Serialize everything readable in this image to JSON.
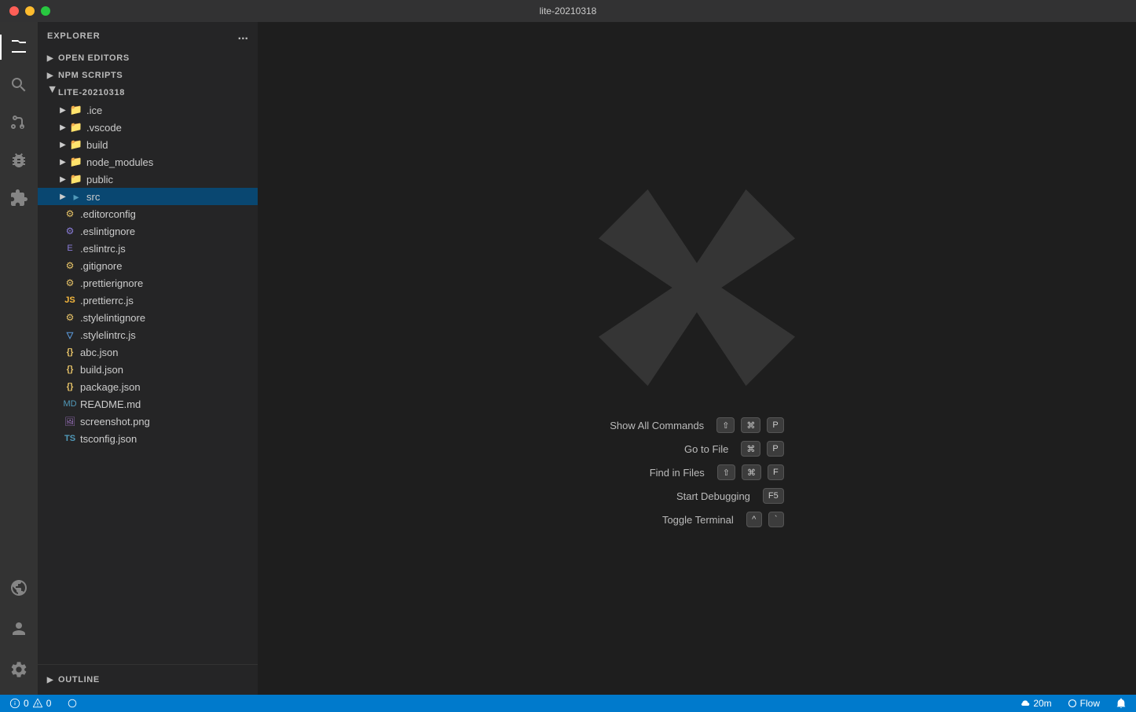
{
  "titlebar": {
    "title": "lite-20210318"
  },
  "activity_bar": {
    "items": [
      {
        "id": "explorer",
        "label": "Explorer",
        "active": true
      },
      {
        "id": "search",
        "label": "Search",
        "active": false
      },
      {
        "id": "source-control",
        "label": "Source Control",
        "active": false
      },
      {
        "id": "debug",
        "label": "Run and Debug",
        "active": false
      },
      {
        "id": "extensions",
        "label": "Extensions",
        "active": false
      }
    ],
    "bottom_items": [
      {
        "id": "remote",
        "label": "Remote Explorer"
      },
      {
        "id": "account",
        "label": "Account"
      },
      {
        "id": "settings",
        "label": "Settings"
      }
    ]
  },
  "sidebar": {
    "header": "Explorer",
    "more_actions": "...",
    "sections": {
      "open_editors": "OPEN EDITORS",
      "npm_scripts": "NPM SCRIPTS",
      "project": "LITE-20210318",
      "outline": "OUTLINE"
    }
  },
  "file_tree": {
    "root": "LITE-20210318",
    "folders": [
      {
        "name": ".ice",
        "depth": 1,
        "expanded": false,
        "icon": "folder"
      },
      {
        "name": ".vscode",
        "depth": 1,
        "expanded": false,
        "icon": "folder"
      },
      {
        "name": "build",
        "depth": 1,
        "expanded": false,
        "icon": "folder"
      },
      {
        "name": "node_modules",
        "depth": 1,
        "expanded": false,
        "icon": "folder"
      },
      {
        "name": "public",
        "depth": 1,
        "expanded": false,
        "icon": "folder"
      },
      {
        "name": "src",
        "depth": 1,
        "expanded": false,
        "icon": "folder-src",
        "selected": true
      }
    ],
    "files": [
      {
        "name": ".editorconfig",
        "depth": 1,
        "icon": "gear"
      },
      {
        "name": ".eslintignore",
        "depth": 1,
        "icon": "gear"
      },
      {
        "name": ".eslintrc.js",
        "depth": 1,
        "icon": "eslint"
      },
      {
        "name": ".gitignore",
        "depth": 1,
        "icon": "gear"
      },
      {
        "name": ".prettierignore",
        "depth": 1,
        "icon": "gear"
      },
      {
        "name": ".prettierrc.js",
        "depth": 1,
        "icon": "prettier"
      },
      {
        "name": ".stylelintignore",
        "depth": 1,
        "icon": "gear"
      },
      {
        "name": ".stylelintrc.js",
        "depth": 1,
        "icon": "gear"
      },
      {
        "name": "abc.json",
        "depth": 1,
        "icon": "json"
      },
      {
        "name": "build.json",
        "depth": 1,
        "icon": "json"
      },
      {
        "name": "package.json",
        "depth": 1,
        "icon": "json"
      },
      {
        "name": "README.md",
        "depth": 1,
        "icon": "md"
      },
      {
        "name": "screenshot.png",
        "depth": 1,
        "icon": "png"
      },
      {
        "name": "tsconfig.json",
        "depth": 1,
        "icon": "ts"
      }
    ]
  },
  "welcome": {
    "shortcuts": [
      {
        "label": "Show All Commands",
        "keys": [
          "⇧",
          "⌘",
          "P"
        ]
      },
      {
        "label": "Go to File",
        "keys": [
          "⌘",
          "P"
        ]
      },
      {
        "label": "Find in Files",
        "keys": [
          "⇧",
          "⌘",
          "F"
        ]
      },
      {
        "label": "Start Debugging",
        "keys": [
          "F5"
        ]
      },
      {
        "label": "Toggle Terminal",
        "keys": [
          "^",
          "`"
        ]
      }
    ]
  },
  "status_bar": {
    "errors": "0",
    "warnings": "0",
    "sync_icon": "sync",
    "remote": "20m",
    "flow": "Flow",
    "bell": "bell",
    "colors": {
      "background": "#007acc"
    }
  }
}
